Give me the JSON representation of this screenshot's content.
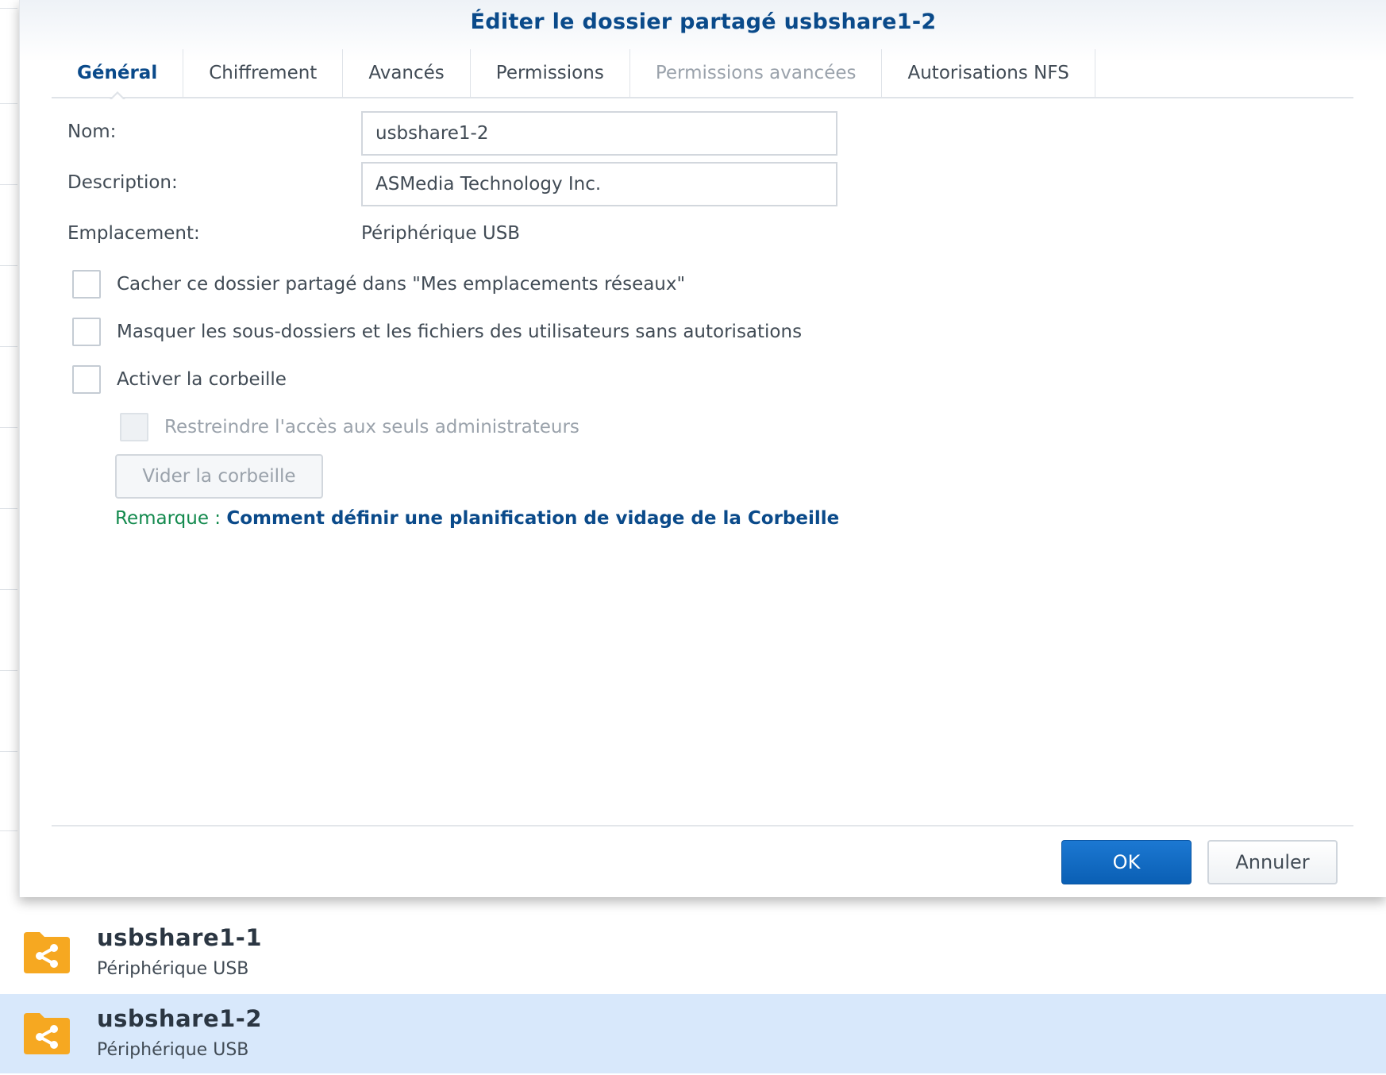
{
  "dialog": {
    "title": "Éditer le dossier partagé usbshare1-2",
    "tabs": [
      {
        "label": "Général",
        "state": "active"
      },
      {
        "label": "Chiffrement",
        "state": "normal"
      },
      {
        "label": "Avancés",
        "state": "normal"
      },
      {
        "label": "Permissions",
        "state": "normal"
      },
      {
        "label": "Permissions avancées",
        "state": "disabled"
      },
      {
        "label": "Autorisations NFS",
        "state": "normal"
      }
    ],
    "form": {
      "name_label": "Nom:",
      "name_value": "usbshare1-2",
      "description_label": "Description:",
      "description_value": "ASMedia Technology Inc.",
      "location_label": "Emplacement:",
      "location_value": "Périphérique USB"
    },
    "options": {
      "hide_network": "Cacher ce dossier partagé dans \"Mes emplacements réseaux\"",
      "hide_subfolders": "Masquer les sous-dossiers et les fichiers des utilisateurs sans autorisations",
      "enable_recycle": "Activer la corbeille",
      "restrict_admin": "Restreindre l'accès aux seuls administrateurs"
    },
    "empty_recycle_button": "Vider la corbeille",
    "note": {
      "label": "Remarque : ",
      "link": "Comment définir une planification de vidage de la Corbeille"
    },
    "ok_button": "OK",
    "cancel_button": "Annuler"
  },
  "shared_folders": [
    {
      "name": "usbshare1-1",
      "location": "Périphérique USB",
      "selected": false
    },
    {
      "name": "usbshare1-2",
      "location": "Périphérique USB",
      "selected": true
    }
  ],
  "colors": {
    "accent": "#0a4a8a",
    "note_green": "#138a4e",
    "folder_orange": "#f6a821",
    "selection": "#d8e8fb"
  }
}
